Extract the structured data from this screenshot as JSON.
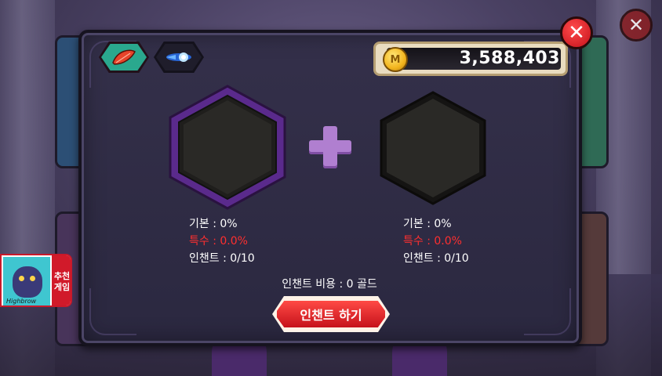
{
  "tabs": [
    {
      "icon": "feather-icon",
      "active": true
    },
    {
      "icon": "energy-blast-icon",
      "active": false
    }
  ],
  "gold": {
    "icon_label": "M",
    "amount": "3,588,403"
  },
  "left_item": {
    "base": "기본 : 0%",
    "special": "특수 : 0.0%",
    "enchant": "인챈트 : 0/10"
  },
  "right_item": {
    "base": "기본 : 0%",
    "special": "특수 : 0.0%",
    "enchant": "인챈트 : 0/10"
  },
  "cost": {
    "text": "인챈트 비용 : 0 골드"
  },
  "enchant_button": {
    "label": "인챈트 하기"
  },
  "promo": {
    "brand": "Highbrow",
    "tag_line1": "추천",
    "tag_line2": "게임"
  },
  "colors": {
    "special_stat": "#ff2f2f",
    "slot_border_active": "#7b3fb0",
    "button_red": "#d11a2a",
    "active_tab": "#2aa88e"
  }
}
